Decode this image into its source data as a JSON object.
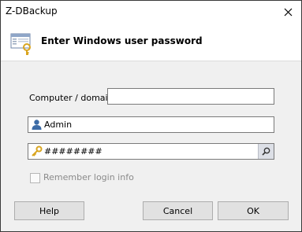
{
  "window": {
    "title": "Z-DBackup"
  },
  "banner": {
    "heading": "Enter Windows user password"
  },
  "form": {
    "computer_label": "Computer / domain:",
    "computer_value": "",
    "username_value": "Admin",
    "password_value": "########",
    "remember_label": "Remember login info",
    "remember_checked": false
  },
  "buttons": {
    "help": "Help",
    "cancel": "Cancel",
    "ok": "OK"
  },
  "icons": {
    "close": "close-icon",
    "app": "app-key-icon",
    "user": "user-icon",
    "key": "key-icon",
    "reveal": "magnifier-icon"
  },
  "colors": {
    "accent_blue": "#3c6ba6",
    "key_gold": "#d9a520"
  }
}
